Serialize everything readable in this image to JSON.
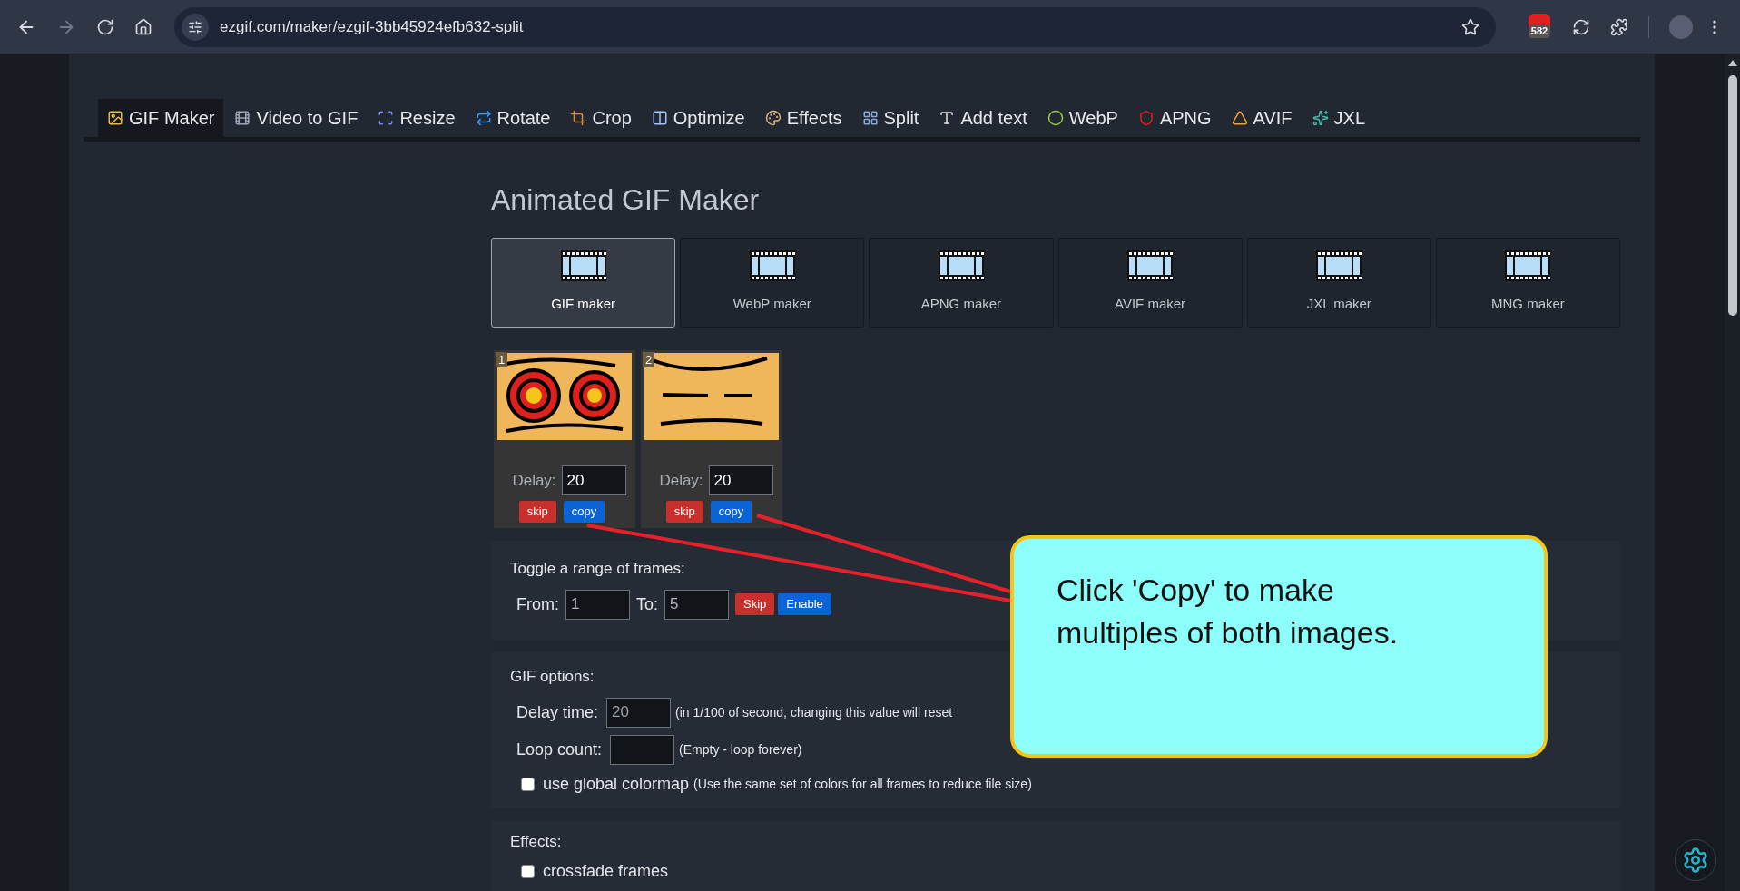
{
  "browser": {
    "url": "ezgif.com/maker/ezgif-3bb45924efb632-split",
    "forward_disabled": true,
    "extension_badge": "582"
  },
  "nav_tabs": [
    {
      "label": "GIF Maker",
      "selected": true
    },
    {
      "label": "Video to GIF",
      "selected": false
    },
    {
      "label": "Resize",
      "selected": false
    },
    {
      "label": "Rotate",
      "selected": false
    },
    {
      "label": "Crop",
      "selected": false
    },
    {
      "label": "Optimize",
      "selected": false
    },
    {
      "label": "Effects",
      "selected": false
    },
    {
      "label": "Split",
      "selected": false
    },
    {
      "label": "Add text",
      "selected": false
    },
    {
      "label": "WebP",
      "selected": false
    },
    {
      "label": "APNG",
      "selected": false
    },
    {
      "label": "AVIF",
      "selected": false
    },
    {
      "label": "JXL",
      "selected": false
    }
  ],
  "page_title": "Animated GIF Maker",
  "maker_tiles": [
    {
      "label": "GIF maker",
      "selected": true
    },
    {
      "label": "WebP maker",
      "selected": false
    },
    {
      "label": "APNG maker",
      "selected": false
    },
    {
      "label": "AVIF maker",
      "selected": false
    },
    {
      "label": "JXL maker",
      "selected": false
    },
    {
      "label": "MNG maker",
      "selected": false
    }
  ],
  "frames": [
    {
      "number": "1",
      "kind": "circles",
      "delay_label": "Delay:",
      "delay": "20",
      "skip": "skip",
      "copy": "copy"
    },
    {
      "number": "2",
      "kind": "lines",
      "delay_label": "Delay:",
      "delay": "20",
      "skip": "skip",
      "copy": "copy"
    }
  ],
  "toggle_range": {
    "title": "Toggle a range of frames:",
    "from_label": "From:",
    "from_placeholder": "1",
    "to_label": "To:",
    "to_placeholder": "5",
    "skip_button": "Skip",
    "enable_button": "Enable"
  },
  "gif_options": {
    "title": "GIF options:",
    "delay_label": "Delay time:",
    "delay_placeholder": "20",
    "delay_note": "(in 1/100 of second, changing this value will reset",
    "loop_label": "Loop count:",
    "loop_note": "(Empty - loop forever)",
    "global_colormap": {
      "label": "use global colormap",
      "note": "(Use the same set of colors for all frames to reduce file size)",
      "checked": false
    }
  },
  "effects": {
    "title": "Effects:",
    "crossfade": {
      "label": "crossfade frames",
      "checked": false
    }
  },
  "callout": {
    "text": "Click 'Copy' to make multiples of both images."
  }
}
